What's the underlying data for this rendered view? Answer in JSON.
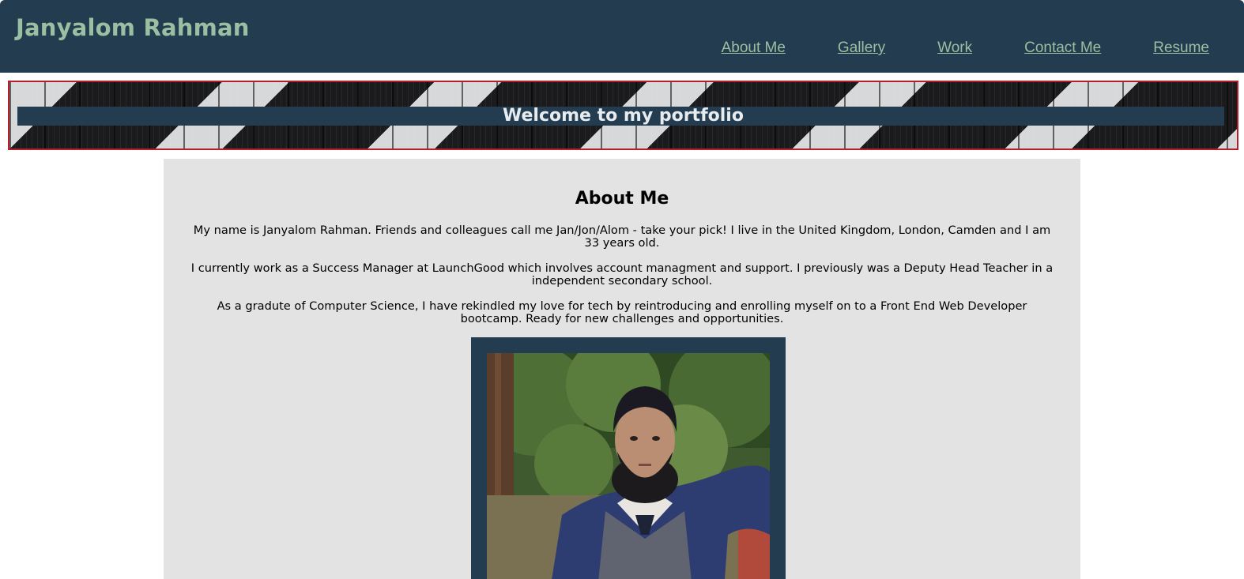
{
  "header": {
    "title": "Janyalom Rahman",
    "nav": [
      "About Me",
      "Gallery",
      "Work",
      "Contact Me",
      "Resume"
    ]
  },
  "banner": {
    "title": "Welcome to my portfolio"
  },
  "about": {
    "heading": "About Me",
    "paragraphs": [
      "My name is Janyalom Rahman. Friends and colleagues call me Jan/Jon/Alom - take your pick! I live in the United Kingdom, London, Camden and I am 33 years old.",
      "I currently work as a Success Manager at LaunchGood which involves account managment and support. I previously was a Deputy Head Teacher in a independent secondary school.",
      "As a gradute of Computer Science, I have rekindled my love for tech by reintroducing and enrolling myself on to a Front End Web Developer bootcamp. Ready for new challenges and opportunities."
    ]
  },
  "colors": {
    "header_bg": "#243c4f",
    "accent_text": "#9bbfa2",
    "banner_border": "#b3202a",
    "section_bg": "#e3e3e3"
  }
}
